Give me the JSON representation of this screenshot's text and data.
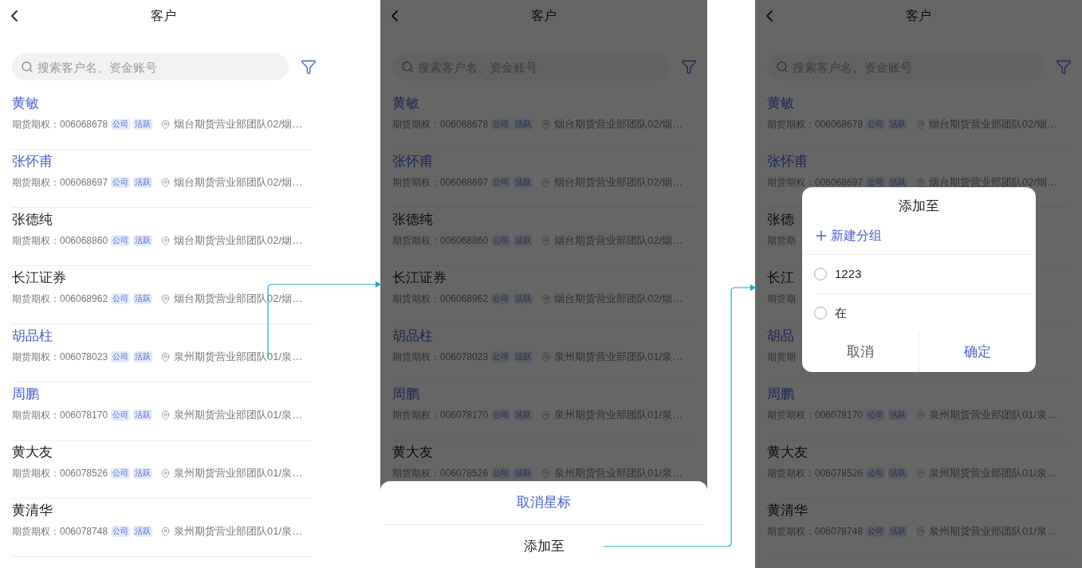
{
  "screens": [
    {
      "title": "客户",
      "search": {
        "placeholder": "搜索客户名、资金账号"
      },
      "customers": [
        {
          "name": "黄敏",
          "highlighted": true,
          "account": "期货期权：006068678",
          "tags": [
            "公司",
            "活跃"
          ],
          "branch": "烟台期货营业部团队02/烟…"
        },
        {
          "name": "张怀甫",
          "highlighted": true,
          "account": "期货期权：006068697",
          "tags": [
            "公司",
            "活跃"
          ],
          "branch": "烟台期货营业部团队02/烟…"
        },
        {
          "name": "张德纯",
          "highlighted": false,
          "account": "期货期权：006068860",
          "tags": [
            "公司",
            "活跃"
          ],
          "branch": "烟台期货营业部团队02/烟…"
        },
        {
          "name": "长江证券",
          "highlighted": false,
          "account": "期货期权：006068962",
          "tags": [
            "公司",
            "活跃"
          ],
          "branch": "烟台期货营业部团队02/烟…"
        },
        {
          "name": "胡品柱",
          "highlighted": true,
          "account": "期货期权：006078023",
          "tags": [
            "公司",
            "活跃"
          ],
          "branch": "泉州期货营业部团队01/泉…"
        },
        {
          "name": "周鹏",
          "highlighted": true,
          "account": "期货期权：006078170",
          "tags": [
            "公司",
            "活跃"
          ],
          "branch": "泉州期货营业部团队01/泉…"
        },
        {
          "name": "黄大友",
          "highlighted": false,
          "account": "期货期权：006078526",
          "tags": [
            "公司",
            "活跃"
          ],
          "branch": "泉州期货营业部团队01/泉…"
        },
        {
          "name": "黄清华",
          "highlighted": false,
          "account": "期货期权：006078748",
          "tags": [
            "公司",
            "活跃"
          ],
          "branch": "泉州期货营业部团队01/泉…"
        }
      ]
    },
    {
      "title": "客户",
      "search": {
        "placeholder": "搜索客户名、资金账号"
      },
      "dimmed": true,
      "customers": [
        {
          "name": "黄敏",
          "highlighted": true,
          "account": "期货期权：006068678",
          "tags": [
            "公司",
            "活跃"
          ],
          "branch": "烟台期货营业部团队02/烟…"
        },
        {
          "name": "张怀甫",
          "highlighted": true,
          "account": "期货期权：006068697",
          "tags": [
            "公司",
            "活跃"
          ],
          "branch": "烟台期货营业部团队02/烟…"
        },
        {
          "name": "张德纯",
          "highlighted": false,
          "account": "期货期权：006068860",
          "tags": [
            "公司",
            "活跃"
          ],
          "branch": "烟台期货营业部团队02/烟…"
        },
        {
          "name": "长江证券",
          "highlighted": false,
          "account": "期货期权：006068962",
          "tags": [
            "公司",
            "活跃"
          ],
          "branch": "烟台期货营业部团队02/烟…"
        },
        {
          "name": "胡品柱",
          "highlighted": true,
          "account": "期货期权：006078023",
          "tags": [
            "公司",
            "活跃"
          ],
          "branch": "泉州期货营业部团队01/泉…"
        },
        {
          "name": "周鹏",
          "highlighted": true,
          "account": "期货期权：006078170",
          "tags": [
            "公司",
            "活跃"
          ],
          "branch": "泉州期货营业部团队01/泉…"
        },
        {
          "name": "黄大友",
          "highlighted": false,
          "account": "期货期权：006078526",
          "tags": [
            "公司",
            "活跃"
          ],
          "branch": "泉州期货营业部团队01/泉…"
        }
      ],
      "overlay": {
        "kind": "action_sheet",
        "actions": [
          {
            "label": "取消星标",
            "primary": true
          },
          {
            "label": "添加至",
            "primary": false
          }
        ]
      }
    },
    {
      "title": "客户",
      "search": {
        "placeholder": "搜索客户名、资金账号"
      },
      "dimmed": true,
      "customers": [
        {
          "name": "黄敏",
          "highlighted": true,
          "account": "期货期权：006068678",
          "tags": [
            "公司",
            "活跃"
          ],
          "branch": "烟台期货营业部团队02/烟…"
        },
        {
          "name": "张怀甫",
          "highlighted": true,
          "account": "期货期权：006068697",
          "tags": [
            "公司",
            "活跃"
          ],
          "branch": "烟台期货营业部团队02/烟…"
        },
        {
          "name": "张德",
          "highlighted": false,
          "account": "期货期"
        },
        {
          "name": "长江",
          "highlighted": false,
          "account": "期货期"
        },
        {
          "name": "胡品",
          "highlighted": true,
          "account": "期货期"
        },
        {
          "name": "周鹏",
          "highlighted": true,
          "account": "期货期权：006078170",
          "tags": [
            "公司",
            "活跃"
          ],
          "branch": "泉州期货营业部团队01/泉…"
        },
        {
          "name": "黄大友",
          "highlighted": false,
          "account": "期货期权：006078526",
          "tags": [
            "公司",
            "活跃"
          ],
          "branch": "泉州期货营业部团队01/泉…"
        },
        {
          "name": "黄清华",
          "highlighted": false,
          "account": "期货期权：006078748",
          "tags": [
            "公司",
            "活跃"
          ],
          "branch": "泉州期货营业部团队01/泉…"
        }
      ],
      "overlay": {
        "kind": "dialog",
        "title": "添加至",
        "new_group": "新建分组",
        "options": [
          {
            "label": "1223",
            "selected": false
          },
          {
            "label": "在",
            "selected": false
          }
        ],
        "buttons": [
          {
            "label": "取消",
            "primary": false
          },
          {
            "label": "确定",
            "primary": true
          }
        ]
      }
    }
  ]
}
